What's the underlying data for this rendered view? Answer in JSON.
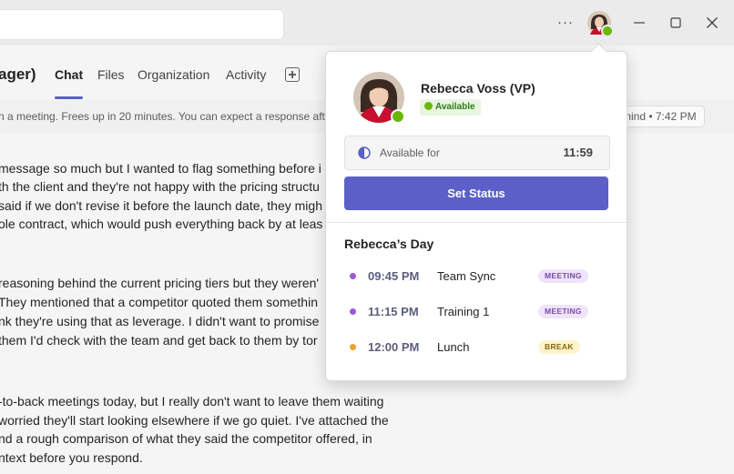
{
  "window": {
    "more_label": "···"
  },
  "header": {
    "chat_title": "ager)",
    "tabs": [
      {
        "label": "Chat"
      },
      {
        "label": "Files"
      },
      {
        "label": "Organization"
      },
      {
        "label": "Activity"
      }
    ]
  },
  "status_banner": {
    "text": "n a meeting. Frees up in 20 minutes. You can expect a response afte",
    "remind_text": "mind • 7:42 PM"
  },
  "messages": {
    "paragraphs": [
      [
        "message so much but I wanted to flag something before i",
        "th the client and they're not happy with the pricing structu",
        "said if we don't revise it before the launch date, they migh",
        "ole contract, which would push everything back by at leas"
      ],
      [
        "reasoning behind the current pricing tiers but they weren'",
        "They mentioned that a competitor quoted them somethin",
        "nk they're using that as leverage. I didn't want to promise",
        "them I'd check with the team and get back to them by tor"
      ],
      [
        "-to-back meetings today, but I really don't want to leave them waiting",
        "worried they'll start looking elsewhere if we go quiet. I've attached the",
        "nd a rough comparison of what they said the competitor offered, in",
        "ntext before you respond."
      ]
    ]
  },
  "profile": {
    "name": "Rebecca Voss (VP)",
    "status": "Available",
    "available_for_label": "Available for",
    "available_for_time": "11:59",
    "set_status_label": "Set Status",
    "day_heading": "Rebecca’s Day",
    "events": [
      {
        "time": "09:45 PM",
        "title": "Team Sync",
        "tag": "MEETING",
        "dot_color": "#9b59d6",
        "tag_bg": "#efe4fb",
        "tag_fg": "#7a4aa8"
      },
      {
        "time": "11:15 PM",
        "title": "Training 1",
        "tag": "MEETING",
        "dot_color": "#9b59d6",
        "tag_bg": "#efe4fb",
        "tag_fg": "#7a4aa8"
      },
      {
        "time": "12:00 PM",
        "title": "Lunch",
        "tag": "BREAK",
        "dot_color": "#f0a030",
        "tag_bg": "#fcf3cf",
        "tag_fg": "#8a6a00"
      }
    ]
  },
  "colors": {
    "accent": "#5b5fc7",
    "presence_available": "#6bb700"
  }
}
